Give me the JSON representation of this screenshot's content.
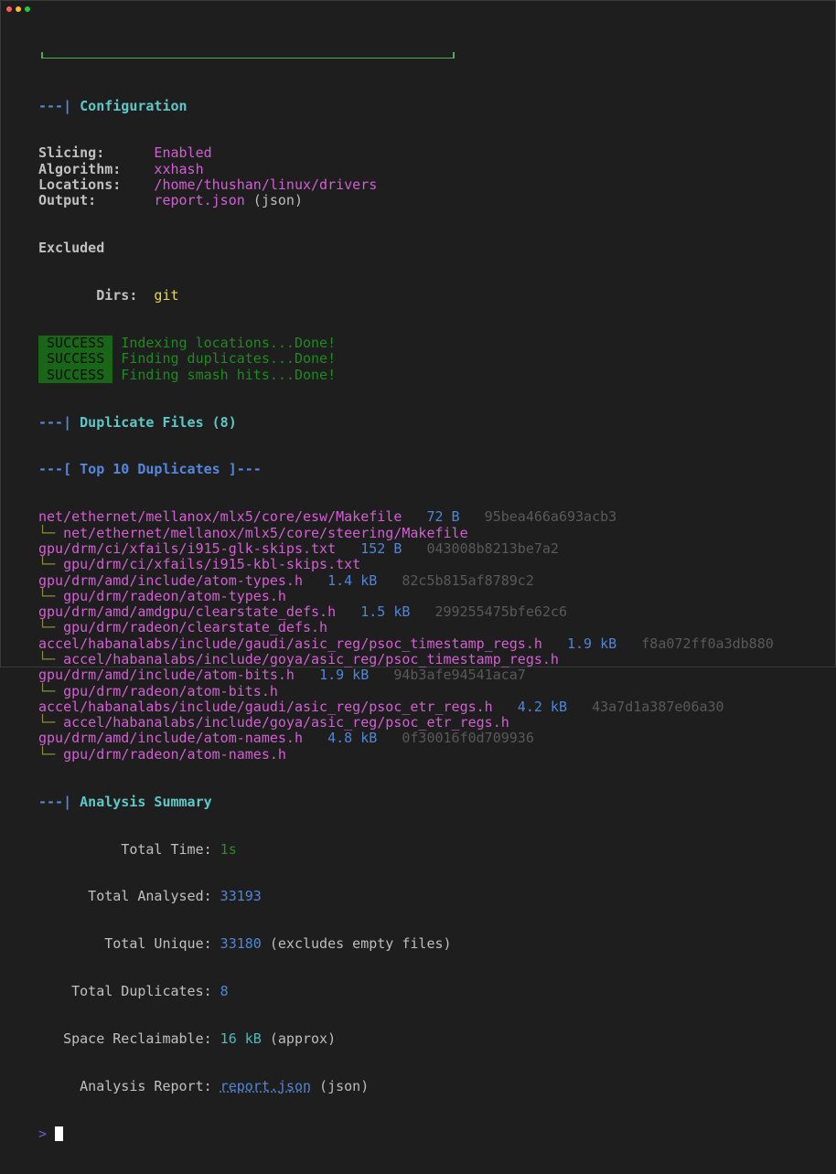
{
  "window": {
    "controls": [
      "close",
      "minimize",
      "maximize"
    ],
    "colors": {
      "close": "#ff5f56",
      "minimize": "#ffbd2e",
      "maximize": "#27c93f"
    }
  },
  "config": {
    "header_prefix": "---| ",
    "header": "Configuration",
    "rows": [
      {
        "label": "Slicing:",
        "value": "Enabled"
      },
      {
        "label": "Algorithm:",
        "value": "xxhash"
      },
      {
        "label": "Locations:",
        "value": "/home/thushan/linux/drivers"
      },
      {
        "label": "Output:",
        "value": "report.json",
        "suffix": " (json)"
      }
    ],
    "excluded_label": "Excluded",
    "dirs_label": "Dirs:",
    "dirs_value": "git"
  },
  "steps": [
    {
      "badge": "SUCCESS",
      "message": "Indexing locations...Done!"
    },
    {
      "badge": "SUCCESS",
      "message": "Finding duplicates...Done!"
    },
    {
      "badge": "SUCCESS",
      "message": "Finding smash hits...Done!"
    }
  ],
  "duplicates": {
    "header_prefix": "---| ",
    "header": "Duplicate Files (8)",
    "top_prefix": "---[ ",
    "top_header": "Top 10 Duplicates",
    "top_suffix": " ]---",
    "tree_glyph": "└─ ",
    "items": [
      {
        "path": "net/ethernet/mellanox/mlx5/core/esw/Makefile",
        "size": "72 B",
        "hash": "95bea466a693acb3",
        "duplicate": "net/ethernet/mellanox/mlx5/core/steering/Makefile"
      },
      {
        "path": "gpu/drm/ci/xfails/i915-glk-skips.txt",
        "size": "152 B",
        "hash": "043008b8213be7a2",
        "duplicate": "gpu/drm/ci/xfails/i915-kbl-skips.txt"
      },
      {
        "path": "gpu/drm/amd/include/atom-types.h",
        "size": "1.4 kB",
        "hash": "82c5b815af8789c2",
        "duplicate": "gpu/drm/radeon/atom-types.h"
      },
      {
        "path": "gpu/drm/amd/amdgpu/clearstate_defs.h",
        "size": "1.5 kB",
        "hash": "299255475bfe62c6",
        "duplicate": "gpu/drm/radeon/clearstate_defs.h"
      },
      {
        "path": "accel/habanalabs/include/gaudi/asic_reg/psoc_timestamp_regs.h",
        "size": "1.9 kB",
        "hash": "f8a072ff0a3db880",
        "duplicate": "accel/habanalabs/include/goya/asic_reg/psoc_timestamp_regs.h"
      },
      {
        "path": "gpu/drm/amd/include/atom-bits.h",
        "size": "1.9 kB",
        "hash": "94b3afe94541aca7",
        "duplicate": "gpu/drm/radeon/atom-bits.h"
      },
      {
        "path": "accel/habanalabs/include/gaudi/asic_reg/psoc_etr_regs.h",
        "size": "4.2 kB",
        "hash": "43a7d1a387e06a30",
        "duplicate": "accel/habanalabs/include/goya/asic_reg/psoc_etr_regs.h"
      },
      {
        "path": "gpu/drm/amd/include/atom-names.h",
        "size": "4.8 kB",
        "hash": "0f30016f0d709936",
        "duplicate": "gpu/drm/radeon/atom-names.h"
      }
    ]
  },
  "summary": {
    "header_prefix": "---| ",
    "header": "Analysis Summary",
    "total_time_label": "Total Time:",
    "total_time": "1s",
    "total_analysed_label": "Total Analysed:",
    "total_analysed": "33193",
    "total_unique_label": "Total Unique:",
    "total_unique": "33180",
    "total_unique_note": " (excludes empty files)",
    "total_duplicates_label": "Total Duplicates:",
    "total_duplicates": "8",
    "space_label": "Space Reclaimable:",
    "space": "16 kB",
    "space_note": " (approx)",
    "report_label": "Analysis Report:",
    "report": "report.json",
    "report_note": " (json)"
  },
  "prompt": {
    "symbol": ">"
  }
}
